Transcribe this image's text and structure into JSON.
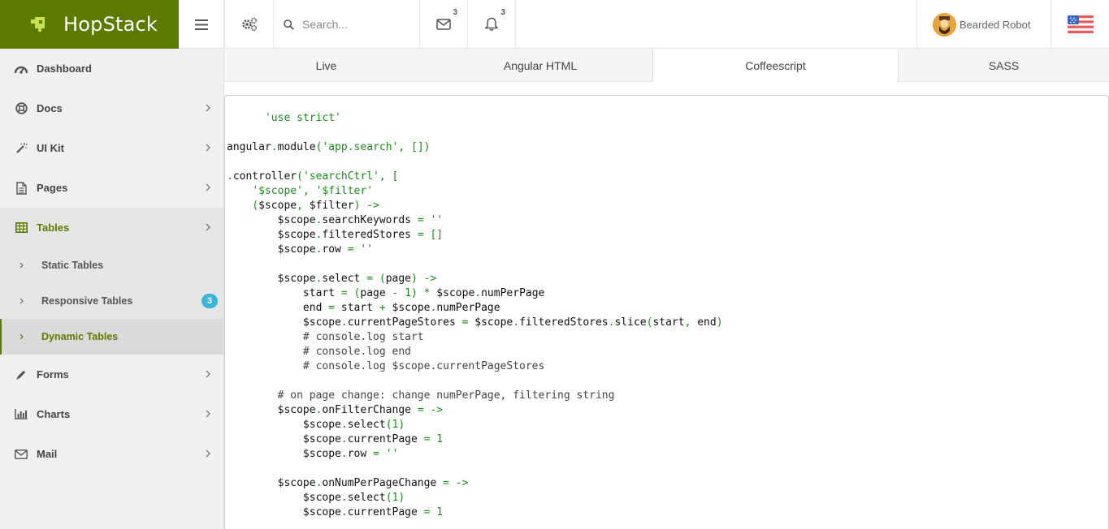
{
  "brand": {
    "name": "HopStack"
  },
  "header": {
    "search_placeholder": "Search...",
    "mail_count": "3",
    "notification_count": "3",
    "user_name": "Bearded Robot"
  },
  "sidebar": {
    "items": [
      {
        "label": "Dashboard",
        "icon": "dashboard-icon"
      },
      {
        "label": "Docs",
        "icon": "lifebuoy-icon"
      },
      {
        "label": "UI Kit",
        "icon": "magic-wand-icon"
      },
      {
        "label": "Pages",
        "icon": "file-icon"
      },
      {
        "label": "Tables",
        "icon": "table-icon"
      },
      {
        "label": "Forms",
        "icon": "pencil-icon"
      },
      {
        "label": "Charts",
        "icon": "bar-chart-icon"
      },
      {
        "label": "Mail",
        "icon": "envelope-icon"
      }
    ],
    "tables_sub": [
      {
        "label": "Static Tables"
      },
      {
        "label": "Responsive Tables",
        "badge": "3"
      },
      {
        "label": "Dynamic Tables"
      }
    ]
  },
  "tabs": [
    "Live",
    "Angular HTML",
    "Coffeescript",
    "SASS"
  ],
  "active_tab": "Coffeescript",
  "colors": {
    "brand": "#5b7b00",
    "badge": "#3ab4d9",
    "code_string": "#1a8a1a"
  },
  "code": {
    "lines": [
      "      'use strict'",
      "",
      "angular.module('app.search', [])",
      "",
      ".controller('searchCtrl', [",
      "    '$scope', '$filter'",
      "    ($scope, $filter) ->",
      "        $scope.searchKeywords = ''",
      "        $scope.filteredStores = []",
      "        $scope.row = ''",
      "",
      "        $scope.select = (page) ->",
      "            start = (page - 1) * $scope.numPerPage",
      "            end = start + $scope.numPerPage",
      "            $scope.currentPageStores = $scope.filteredStores.slice(start, end)",
      "            # console.log start",
      "            # console.log end",
      "            # console.log $scope.currentPageStores",
      "",
      "        # on page change: change numPerPage, filtering string",
      "        $scope.onFilterChange = ->",
      "            $scope.select(1)",
      "            $scope.currentPage = 1",
      "            $scope.row = ''",
      "",
      "        $scope.onNumPerPageChange = ->",
      "            $scope.select(1)",
      "            $scope.currentPage = 1"
    ]
  }
}
